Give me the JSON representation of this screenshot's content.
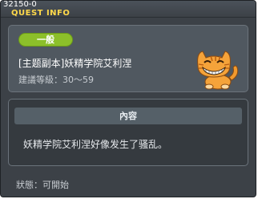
{
  "window": {
    "id_label": "32150-0",
    "title": "QUEST INFO"
  },
  "quest": {
    "category": "一般",
    "name": "[主题副本]妖精学院艾利涅",
    "recommended_level_label": "建議等級：",
    "recommended_level_value": "30～59",
    "character_icon": "orange-cat-icon"
  },
  "content": {
    "header": "內容",
    "description": "妖精学院艾利涅好像发生了骚乱。"
  },
  "status": {
    "label": "狀態：",
    "value": "可開始"
  },
  "colors": {
    "title": "#ffd94a",
    "badge": "#8cbf2a",
    "window_bg": "#3c4147"
  }
}
